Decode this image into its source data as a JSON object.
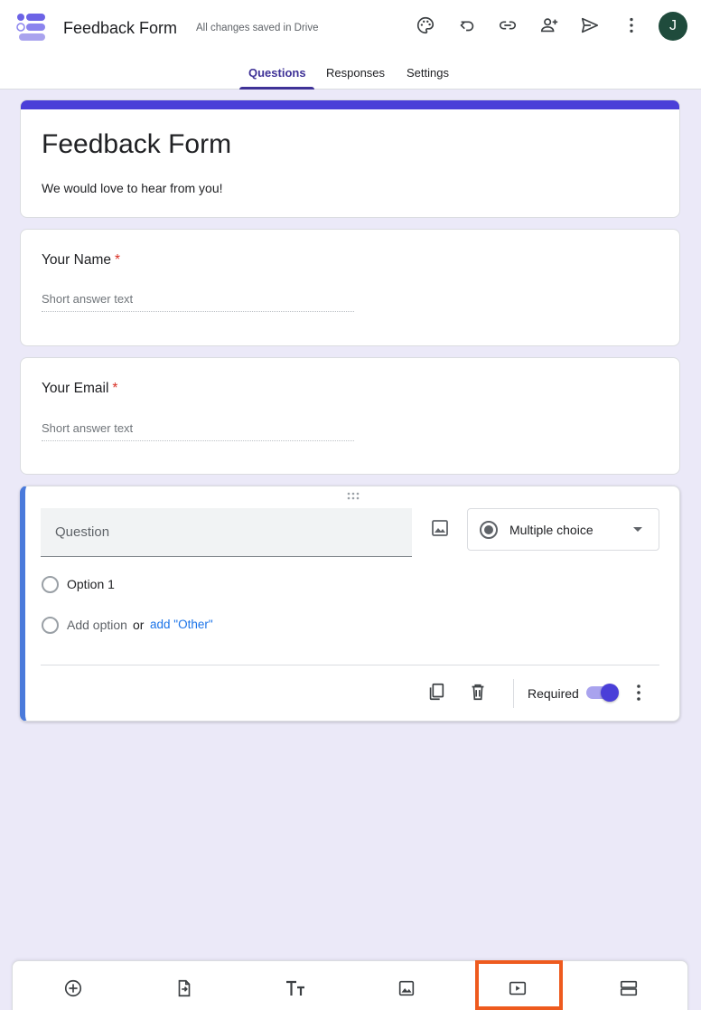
{
  "header": {
    "app_title": "Feedback Form",
    "save_status": "All changes saved in Drive",
    "avatar_initial": "J",
    "icons": [
      "palette-icon",
      "undo-icon",
      "link-icon",
      "add-collaborator-icon",
      "send-icon",
      "more-vert-icon"
    ]
  },
  "tabs": [
    {
      "label": "Questions",
      "active": true
    },
    {
      "label": "Responses",
      "active": false
    },
    {
      "label": "Settings",
      "active": false
    }
  ],
  "form": {
    "title": "Feedback Form",
    "description": "We would love to hear from you!",
    "accent_color": "#4a3fd8",
    "background_color": "#ebe9f8"
  },
  "questions": [
    {
      "title": "Your Name",
      "required_mark": "*",
      "answer_placeholder": "Short answer text"
    },
    {
      "title": "Your Email",
      "required_mark": "*",
      "answer_placeholder": "Short answer text"
    }
  ],
  "active_question": {
    "placeholder": "Question",
    "type": "Multiple choice",
    "options": [
      "Option 1"
    ],
    "add_option": "Add option",
    "or_text": "or",
    "add_other": "add \"Other\"",
    "required_label": "Required",
    "required_on": true
  },
  "bottom_toolbar": {
    "icons": [
      "add-question-icon",
      "import-questions-icon",
      "add-title-icon",
      "add-image-icon",
      "add-video-icon",
      "add-section-icon"
    ],
    "highlighted": "add-video-icon",
    "highlight_color": "#ee5a1e"
  }
}
